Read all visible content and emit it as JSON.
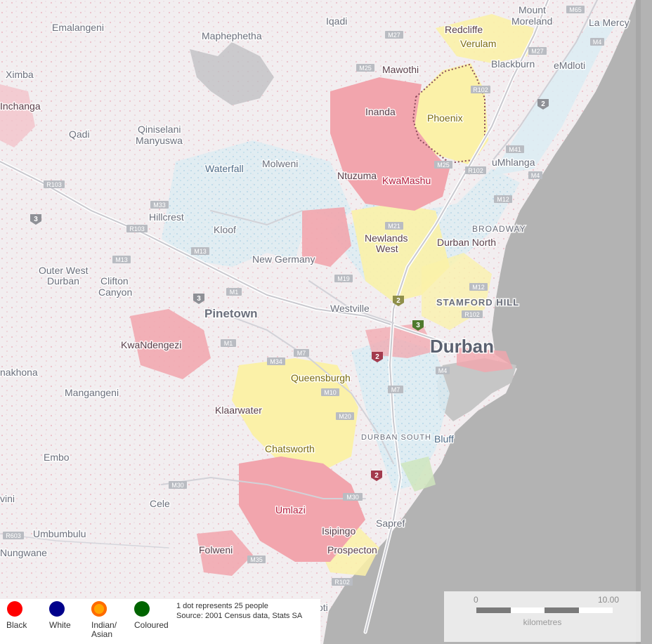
{
  "places": {
    "emalangeni": "Emalangeni",
    "maphephetha": "Maphephetha",
    "iqadi": "Iqadi",
    "mount": "Mount",
    "moreland": "Moreland",
    "la_mercy": "La Mercy",
    "ximba": "Ximba",
    "redcliffe": "Redcliffe",
    "verulam": "Verulam",
    "mawothi": "Mawothi",
    "blackburn": "Blackburn",
    "emdloti": "eMdloti",
    "inchanga": "Inchanga",
    "qadi": "Qadi",
    "qiniselani": "Qiniselani",
    "manyuswa": "Manyuswa",
    "inanda": "Inanda",
    "phoenix": "Phoenix",
    "waterfall": "Waterfall",
    "molweni": "Molweni",
    "ntuzuma": "Ntuzuma",
    "kwamashu": "KwaMashu",
    "umhlanga": "uMhlanga",
    "hillcrest": "Hillcrest",
    "kloof": "Kloof",
    "broadway": "BROADWAY",
    "newlands": "Newlands",
    "newlands_west": "West",
    "durban_north": "Durban North",
    "new_germany": "New Germany",
    "outer_west": "Outer West",
    "outer_west_durban": "Durban",
    "clifton": "Clifton",
    "canyon": "Canyon",
    "stamford_hill": "STAMFORD HILL",
    "pinetown": "Pinetown",
    "westville": "Westville",
    "durban": "Durban",
    "kwandengezi": "KwaNdengezi",
    "nakhona": "nakhona",
    "queensburgh": "Queensburgh",
    "mangangeni": "Mangangeni",
    "klaarwater": "Klaarwater",
    "durban_south": "DURBAN SOUTH",
    "bluff": "Bluff",
    "chatsworth": "Chatsworth",
    "embo": "Embo",
    "cele": "Cele",
    "umlazi": "Umlazi",
    "vini": "vini",
    "sapref": "Sapref",
    "isipingo": "Isipingo",
    "umbumbulu": "Umbumbulu",
    "folweni": "Folweni",
    "prospecton": "Prospecton",
    "nungwane": "Nungwane",
    "oti": "oti"
  },
  "road_shields": {
    "m65": "M65",
    "m4": "M4",
    "m4b": "M4",
    "m4c": "M4",
    "m27a": "M27",
    "m27b": "M27",
    "m25a": "M25",
    "m25b": "M25",
    "r102a": "R102",
    "r102b": "R102",
    "r102c": "R102",
    "r102d": "R102",
    "m41": "M41",
    "r103a": "R103",
    "r103b": "R103",
    "m33": "M33",
    "m13a": "M13",
    "m13b": "M13",
    "m12a": "M12",
    "m12b": "M12",
    "m21": "M21",
    "m19": "M19",
    "m1a": "M1",
    "m1b": "M1",
    "m34": "M34",
    "m7a": "M7",
    "m7b": "M7",
    "m10": "M10",
    "m20": "M20",
    "m30a": "M30",
    "m30b": "M30",
    "m35": "M35",
    "r603": "R603"
  },
  "route_markers": {
    "n2a": "2",
    "n2b": "2",
    "n2c": "2",
    "n2d": "2",
    "n3a": "3",
    "n3b": "3",
    "n3c": "3"
  },
  "legend": {
    "items": [
      {
        "label": "Black",
        "color": "#ff0000"
      },
      {
        "label": "White",
        "color": "#00008b"
      },
      {
        "label": "Indian/\nAsian",
        "color": "#ffa500"
      },
      {
        "label": "Coloured",
        "color": "#006400"
      }
    ],
    "note_line1": "1 dot represents  25 people",
    "note_line2": "Source: 2001 Census data, Stats SA"
  },
  "scale": {
    "start_label": "0",
    "end_label": "10.00",
    "unit_label": "kilometres"
  },
  "colors": {
    "black_population": "#ff0000",
    "white_population": "#00008b",
    "indian_asian_population": "#ffa500",
    "coloured_population": "#006400",
    "ocean": "#b3b3b3"
  }
}
